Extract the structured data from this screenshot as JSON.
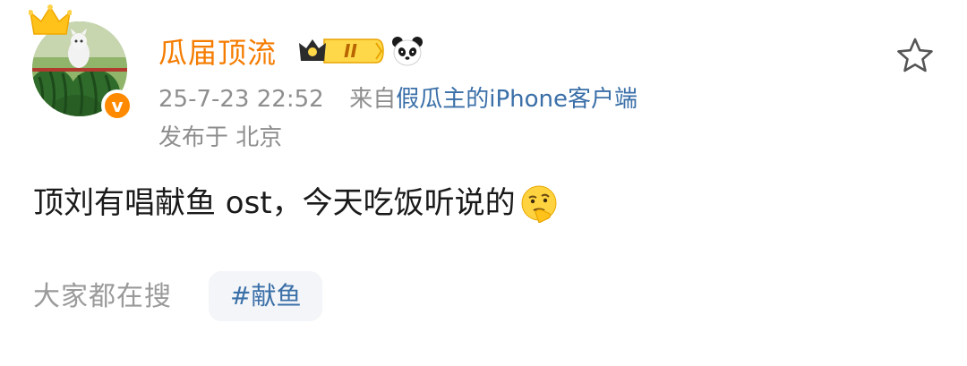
{
  "post": {
    "author": {
      "name": "瓜届顶流",
      "level_badge": "II",
      "verified_mark": "v",
      "icons": [
        "crown-icon",
        "level-crown-icon",
        "panda-icon",
        "verified-icon"
      ]
    },
    "meta": {
      "timestamp": "25-7-23 22:52",
      "source_prefix": "来自",
      "source_name": "假瓜主的iPhone客户端",
      "location": "发布于 北京"
    },
    "body_text": "顶刘有唱献鱼 ost，今天吃饭听说的",
    "trending": {
      "label": "大家都在搜",
      "hashtag": "#献鱼"
    }
  },
  "colors": {
    "username": "#f57c00",
    "meta_text": "#8e8e8e",
    "link": "#3a6fa8",
    "chip_bg": "#f3f5f8",
    "verified_badge": "#ff8a00"
  }
}
